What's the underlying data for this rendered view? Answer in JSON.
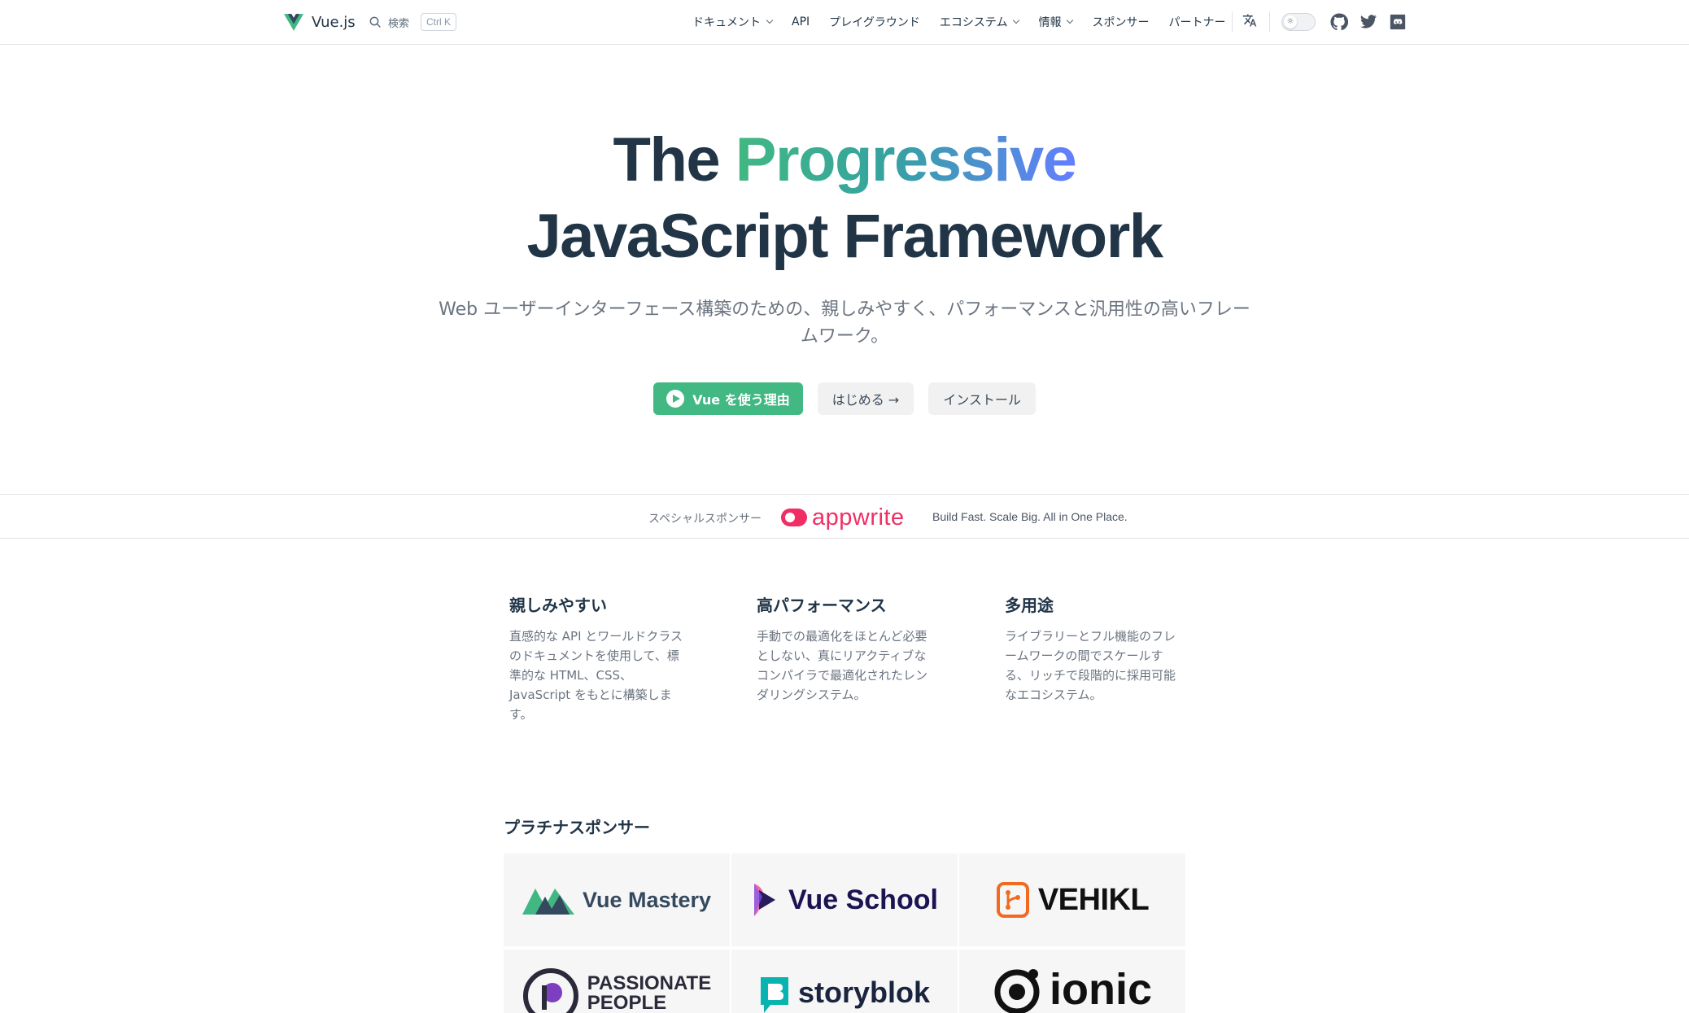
{
  "nav": {
    "brand": "Vue.js",
    "search_label": "検索",
    "search_shortcut": "Ctrl K",
    "items": [
      {
        "label": "ドキュメント",
        "dropdown": true
      },
      {
        "label": "API",
        "dropdown": false
      },
      {
        "label": "プレイグラウンド",
        "dropdown": false
      },
      {
        "label": "エコシステム",
        "dropdown": true
      },
      {
        "label": "情報",
        "dropdown": true
      },
      {
        "label": "スポンサー",
        "dropdown": false
      },
      {
        "label": "パートナー",
        "dropdown": false
      }
    ],
    "translate_glyph": "文A",
    "icons": [
      "translate-icon",
      "sun-icon",
      "github-icon",
      "twitter-icon",
      "discord-icon"
    ]
  },
  "hero": {
    "title_prefix": "The",
    "title_accent": "Progressive",
    "title_line2": "JavaScript Framework",
    "tagline": "Web ユーザーインターフェース構築のための、親しみやすく、パフォーマンスと汎用性の高いフレームワーク。",
    "actions": {
      "primary": "Vue を使う理由",
      "start": "はじめる →",
      "install": "インストール"
    }
  },
  "special_sponsor": {
    "label": "スペシャルスポンサー",
    "name": "appwrite",
    "tagline": "Build Fast. Scale Big. All in One Place."
  },
  "features": [
    {
      "title": "親しみやすい",
      "text": "直感的な API とワールドクラスのドキュメントを使用して、標準的な HTML、CSS、JavaScript をもとに構築します。"
    },
    {
      "title": "高パフォーマンス",
      "text": "手動での最適化をほとんど必要としない、真にリアクティブなコンパイラで最適化されたレンダリングシステム。"
    },
    {
      "title": "多用途",
      "text": "ライブラリーとフル機能のフレームワークの間でスケールする、リッチで段階的に採用可能なエコシステム。"
    }
  ],
  "platinum": {
    "heading": "プラチナスポンサー",
    "sponsors": [
      {
        "name": "Vue Mastery"
      },
      {
        "name": "Vue School"
      },
      {
        "name": "VEHIKL"
      },
      {
        "name_line1": "PASSIONATE",
        "name_line2": "PEOPLE"
      },
      {
        "name": "storyblok"
      },
      {
        "name": "ionic"
      }
    ]
  },
  "colors": {
    "vue_green": "#42b883",
    "text_dark": "#213547",
    "gradient_end": "#647eff",
    "appwrite_pink": "#f02e65"
  }
}
